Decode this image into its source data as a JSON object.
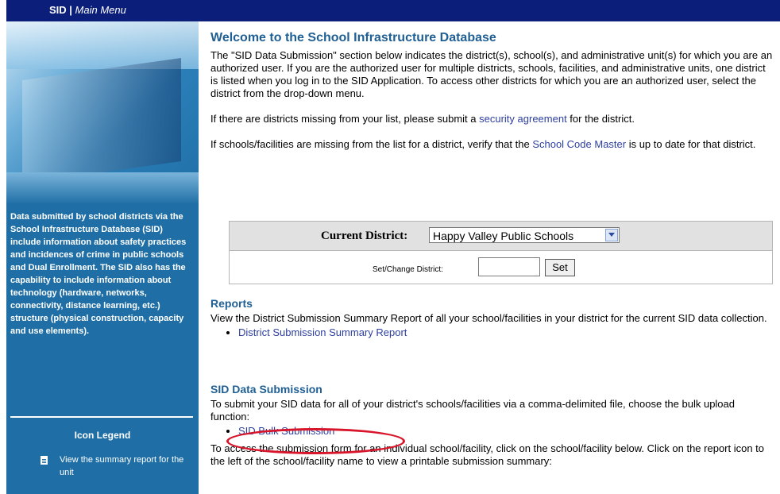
{
  "topbar": {
    "app": "SID",
    "separator": " | ",
    "menu": "Main Menu"
  },
  "sidebar": {
    "description": "Data submitted by school districts via the School Infrastructure Database (SID) include information about safety practices and incidences of crime in public schools and Dual Enrollment. The SID also has the capability to include information about technology (hardware, networks, connectivity, distance learning, etc.) structure (physical construction, capacity and use elements).",
    "legend_title": "Icon Legend",
    "legend_items": [
      {
        "icon": "report-icon",
        "text": "View the summary report for the unit"
      }
    ]
  },
  "welcome": {
    "title": "Welcome to the School Infrastructure Database",
    "paragraph1": "The \"SID Data Submission\" section below indicates the district(s), school(s), and administrative unit(s) for which you are an authorized user. If you are the authorized user for multiple districts, schools, facilities, and administrative units, one district is listed when you log in to the SID Application. To access other districts for which you are an authorized user, select the district from the drop-down menu.",
    "p2_before": "If there are districts missing from your list, please submit a ",
    "p2_link": "security agreement",
    "p2_after": " for the district.",
    "p3_before": "If schools/facilities are missing from the list for a district, verify that the ",
    "p3_link": "School Code Master",
    "p3_after": " is up to date for that district."
  },
  "district": {
    "label": "Current District:",
    "selected": "Happy Valley Public Schools",
    "set_label": "Set/Change District:",
    "set_value": "",
    "set_button": "Set"
  },
  "reports": {
    "title": "Reports",
    "text": "View the District Submission Summary Report of all your school/facilities in your district for the current SID data collection.",
    "link": "District Submission Summary Report"
  },
  "submission": {
    "title": "SID Data Submission",
    "text": "To submit your SID data for all of your district's schools/facilities via a comma-delimited file, choose the bulk upload function:",
    "link": "SID Bulk Submission",
    "text2": "To access the submission form for an individual school/facility, click on the school/facility below. Click on the report icon to the left of the school/facility name to view a printable submission summary:"
  },
  "colors": {
    "navy": "#0b1f7a",
    "sidebar": "#1f6fa6",
    "heading": "#1f5f94",
    "link": "#2d3fa0",
    "highlight": "#d8152a"
  }
}
